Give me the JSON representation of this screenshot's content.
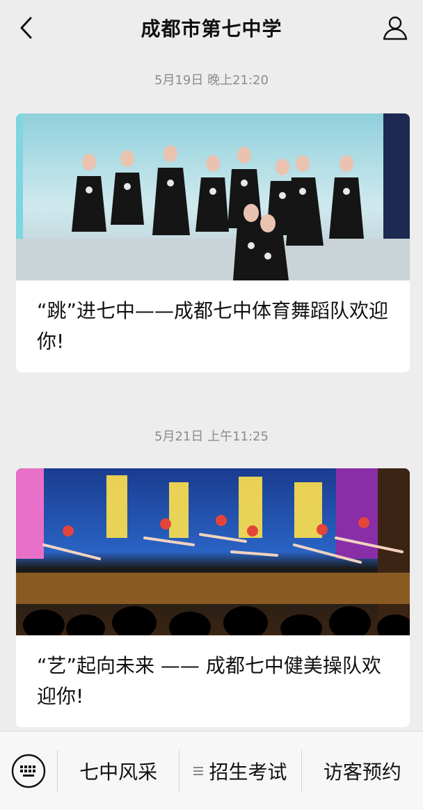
{
  "header": {
    "title": "成都市第七中学",
    "back_icon": "chevron-left-icon",
    "profile_icon": "user-icon"
  },
  "feed": [
    {
      "time": "5月19日 晚上21:20",
      "caption": "“跳”进七中——成都七中体育舞蹈队欢迎你!"
    },
    {
      "time": "5月21日 上午11:25",
      "caption": "“艺”起向未来 —— 成都七中健美操队欢迎你!"
    }
  ],
  "tabbar": {
    "keyboard_icon": "keyboard-icon",
    "tabs": [
      {
        "label": "七中风采"
      },
      {
        "label": "招生考试",
        "icon": "menu-icon"
      },
      {
        "label": "访客预约"
      }
    ]
  },
  "colors": {
    "background": "#ededed",
    "card": "#ffffff",
    "timestamp": "#8c8c8c",
    "tabbar": "#f7f7f7"
  }
}
